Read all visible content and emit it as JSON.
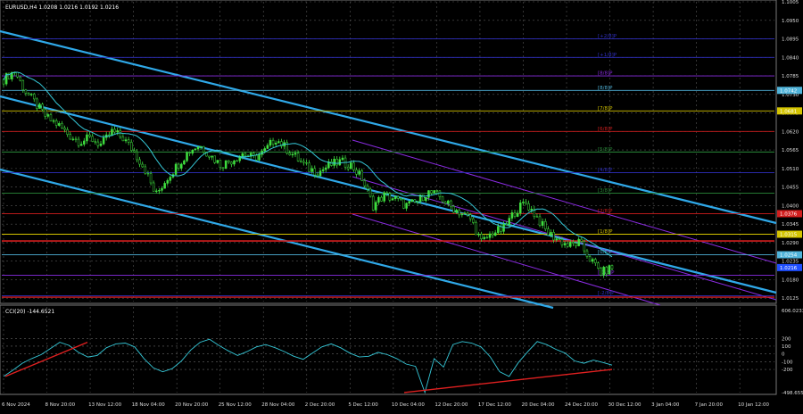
{
  "chart_data": {
    "type": "candlestick",
    "symbol_header": "EURUSD,H4  1.0208 1.0216 1.0192 1.0216",
    "price_axis": {
      "ylim": [
        1.0115,
        1.1005
      ],
      "ticks": [
        "1.1005",
        "1.0950",
        "1.0895",
        "1.0840",
        "1.0785",
        "1.0730",
        "1.0675",
        "1.0620",
        "1.0565",
        "1.0510",
        "1.0455",
        "1.0400",
        "1.0345",
        "1.0290",
        "1.0235",
        "1.0180",
        "1.0125"
      ]
    },
    "x_axis": {
      "ticks": [
        "6 Nov 2024",
        "8 Nov 20:00",
        "13 Nov 12:00",
        "18 Nov 04:00",
        "20 Nov 20:00",
        "25 Nov 12:00",
        "28 Nov 04:00",
        "2 Dec 20:00",
        "5 Dec 12:00",
        "10 Dec 04:00",
        "12 Dec 20:00",
        "17 Dec 12:00",
        "20 Dec 04:00",
        "24 Dec 20:00",
        "30 Dec 12:00",
        "3 Jan 04:00",
        "7 Jan 20:00",
        "10 Jan 12:00"
      ]
    },
    "close_series": [
      1.0775,
      1.08,
      1.074,
      1.07,
      1.066,
      1.064,
      1.061,
      1.059,
      1.06,
      1.058,
      1.062,
      1.06,
      1.056,
      1.051,
      1.043,
      1.048,
      1.052,
      1.056,
      1.058,
      1.055,
      1.052,
      1.0535,
      1.0555,
      1.054,
      1.056,
      1.06,
      1.057,
      1.054,
      1.051,
      1.05,
      1.052,
      1.053,
      1.052,
      1.048,
      1.04,
      1.043,
      1.042,
      1.04,
      1.041,
      1.044,
      1.043,
      1.04,
      1.038,
      1.036,
      1.029,
      1.032,
      1.033,
      1.038,
      1.041,
      1.037,
      1.032,
      1.03,
      1.028,
      1.029,
      1.024,
      1.02,
      1.0216
    ],
    "murrey_levels": [
      {
        "label": "[+2/8]P",
        "price": 1.0895,
        "color": "#2f2fbf"
      },
      {
        "label": "[+1/8]P",
        "price": 1.084,
        "color": "#2f2fbf"
      },
      {
        "label": "[8/8]P",
        "price": 1.0785,
        "color": "#8a2be2"
      },
      {
        "label": "[8/8]P",
        "price": 1.0742,
        "color": "#4fb3d9"
      },
      {
        "label": "[7/8]P",
        "price": 1.0681,
        "color": "#d4c400"
      },
      {
        "label": "[6/8]P",
        "price": 1.062,
        "color": "#d21e1e"
      },
      {
        "label": "[5/8]P",
        "price": 1.0559,
        "color": "#2a8a3a"
      },
      {
        "label": "[4/8]P",
        "price": 1.0498,
        "color": "#2f2fbf"
      },
      {
        "label": "[3/8]P",
        "price": 1.0437,
        "color": "#2a8a3a"
      },
      {
        "label": "[2/8]P",
        "price": 1.0376,
        "color": "#d21e1e"
      },
      {
        "label": "[1/8]P",
        "price": 1.0315,
        "color": "#d4c400"
      },
      {
        "label": "[0/8]P",
        "price": 1.0254,
        "color": "#4fb3d9"
      },
      {
        "label": "[-1/8]P",
        "price": 1.0193,
        "color": "#8a2be2"
      },
      {
        "label": "[-2/8]P",
        "price": 1.0132,
        "color": "#2f2fbf"
      }
    ],
    "price_tags": [
      {
        "text": "1.0742",
        "price": 1.0742,
        "color": "#4fb3d9"
      },
      {
        "text": "1.0681",
        "price": 1.0681,
        "color": "#d4c400"
      },
      {
        "text": "1.0376",
        "price": 1.0376,
        "color": "#d21e1e"
      },
      {
        "text": "1.0315",
        "price": 1.0315,
        "color": "#d4c400"
      },
      {
        "text": "1.0254",
        "price": 1.0254,
        "color": "#4fb3d9"
      },
      {
        "text": "1.0216",
        "price": 1.0216,
        "color": "#1f4fff"
      }
    ],
    "cci": {
      "header": "CCI(20) -144.6521",
      "ylim": [
        -498.6555,
        606.0233
      ],
      "ticks": [
        "606.0233",
        "200",
        "100",
        "0",
        "-100",
        "-200",
        "-498.6555"
      ],
      "values": [
        -290,
        -210,
        -120,
        -60,
        -10,
        70,
        150,
        110,
        20,
        -40,
        -20,
        80,
        130,
        140,
        90,
        -60,
        -180,
        -230,
        -190,
        -90,
        50,
        150,
        190,
        110,
        40,
        -20,
        30,
        90,
        120,
        80,
        30,
        -30,
        -70,
        10,
        90,
        130,
        80,
        10,
        -40,
        -30,
        20,
        -10,
        -60,
        -130,
        -160,
        -498,
        -60,
        -170,
        120,
        160,
        140,
        90,
        -40,
        -230,
        -290,
        -110,
        30,
        160,
        120,
        60,
        10,
        -90,
        -120,
        -80,
        -110,
        -144.65
      ]
    }
  }
}
